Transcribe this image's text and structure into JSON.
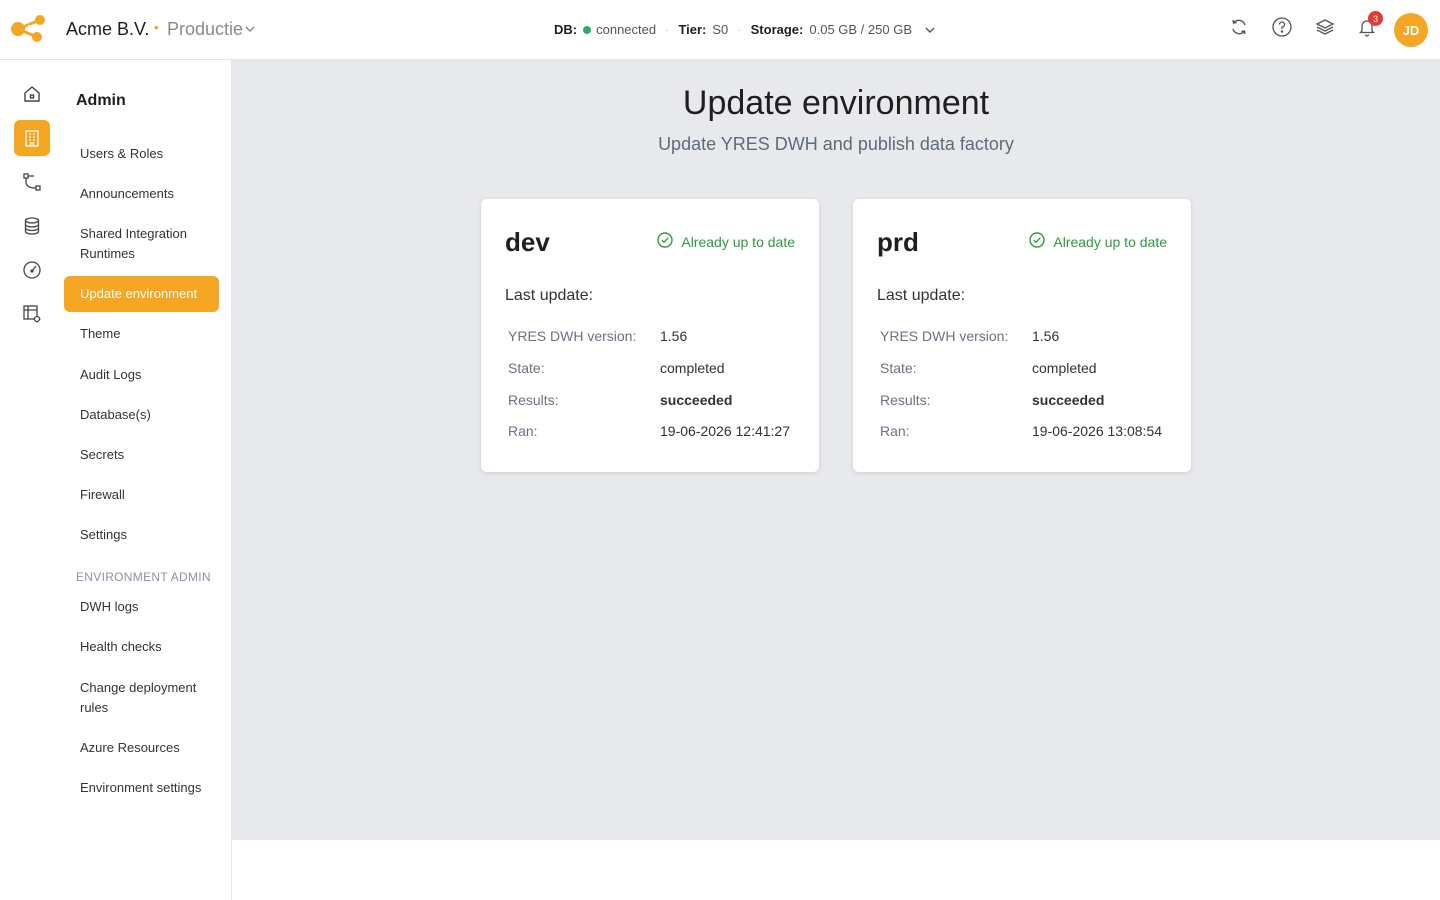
{
  "header": {
    "company": "Acme B.V.",
    "environment": "Productie",
    "status": {
      "db_label": "DB:",
      "db_value": "connected",
      "tier_label": "Tier:",
      "tier_value": "S0",
      "storage_label": "Storage:",
      "storage_value": "0.05 GB / 250 GB"
    },
    "notifications_count": "3",
    "user_initials": "JD",
    "colors": {
      "accent": "#f5a623",
      "success": "#2e9a3e",
      "badge": "#e53935"
    }
  },
  "rail": {
    "icons": [
      "home-icon",
      "building-icon",
      "pipeline-icon",
      "database-icon",
      "gauge-icon",
      "table-settings-icon"
    ],
    "active": "building-icon"
  },
  "sidebar": {
    "title": "Admin",
    "items": [
      {
        "label": "Users & Roles"
      },
      {
        "label": "Announcements"
      },
      {
        "label": "Shared Integration Runtimes"
      },
      {
        "label": "Update environment",
        "active": true
      },
      {
        "label": "Theme"
      },
      {
        "label": "Audit Logs"
      },
      {
        "label": "Database(s)"
      },
      {
        "label": "Secrets"
      },
      {
        "label": "Firewall"
      },
      {
        "label": "Settings"
      }
    ],
    "section_title": "ENVIRONMENT ADMIN",
    "section_items": [
      {
        "label": "DWH logs"
      },
      {
        "label": "Health checks"
      },
      {
        "label": "Change deployment rules"
      },
      {
        "label": "Azure Resources"
      },
      {
        "label": "Environment settings"
      }
    ]
  },
  "main": {
    "title": "Update environment",
    "subtitle": "Update YRES DWH and publish data factory",
    "cards": [
      {
        "env": "dev",
        "status": "Already up to date",
        "last_update_label": "Last update:",
        "rows": [
          {
            "key": "YRES DWH version:",
            "value": "1.56"
          },
          {
            "key": "State:",
            "value": "completed"
          },
          {
            "key": "Results:",
            "value": "succeeded"
          },
          {
            "key": "Ran:",
            "value": "19-06-2026 12:41:27"
          }
        ]
      },
      {
        "env": "prd",
        "status": "Already up to date",
        "last_update_label": "Last update:",
        "rows": [
          {
            "key": "YRES DWH version:",
            "value": "1.56"
          },
          {
            "key": "State:",
            "value": "completed"
          },
          {
            "key": "Results:",
            "value": "succeeded"
          },
          {
            "key": "Ran:",
            "value": "19-06-2026 13:08:54"
          }
        ]
      }
    ]
  }
}
